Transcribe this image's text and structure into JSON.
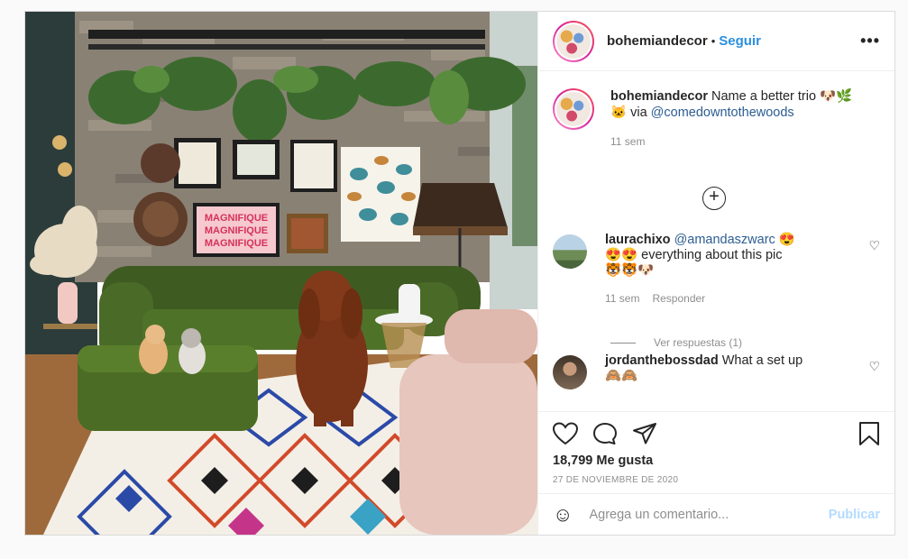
{
  "post": {
    "username": "bohemiandecor",
    "separator": "•",
    "follow_label": "Seguir",
    "more_label": "•••"
  },
  "caption": {
    "username": "bohemiandecor",
    "text": "Name a better trio",
    "emojis": "🐶🌿🐱",
    "via": "via",
    "mention": "@comedowntothewoods",
    "time": "11 sem"
  },
  "load_more_label": "+",
  "comments": [
    {
      "username": "laurachixo",
      "mention": "@amandaszwarc",
      "emoji_a": "😍",
      "emoji_b": "😍😍",
      "text": "everything about this pic",
      "emoji_c": "🐯🐯🐶",
      "time": "11 sem",
      "reply_label": "Responder",
      "view_replies": "Ver respuestas (1)"
    },
    {
      "username": "jordanthebossdad",
      "text": "What a set up",
      "emoji": "🙈🙈"
    }
  ],
  "actions": {
    "likes": "18,799 Me gusta",
    "date": "27 DE NOVIEMBRE DE 2020"
  },
  "composer": {
    "placeholder": "Agrega un comentario...",
    "publish_label": "Publicar"
  },
  "icons": {
    "like": "heart-icon",
    "comment": "comment-icon",
    "share": "send-icon",
    "save": "bookmark-icon",
    "emoji": "emoji-icon"
  },
  "colors": {
    "link": "#2b8fe0",
    "publish_disabled": "#b3dbff"
  }
}
